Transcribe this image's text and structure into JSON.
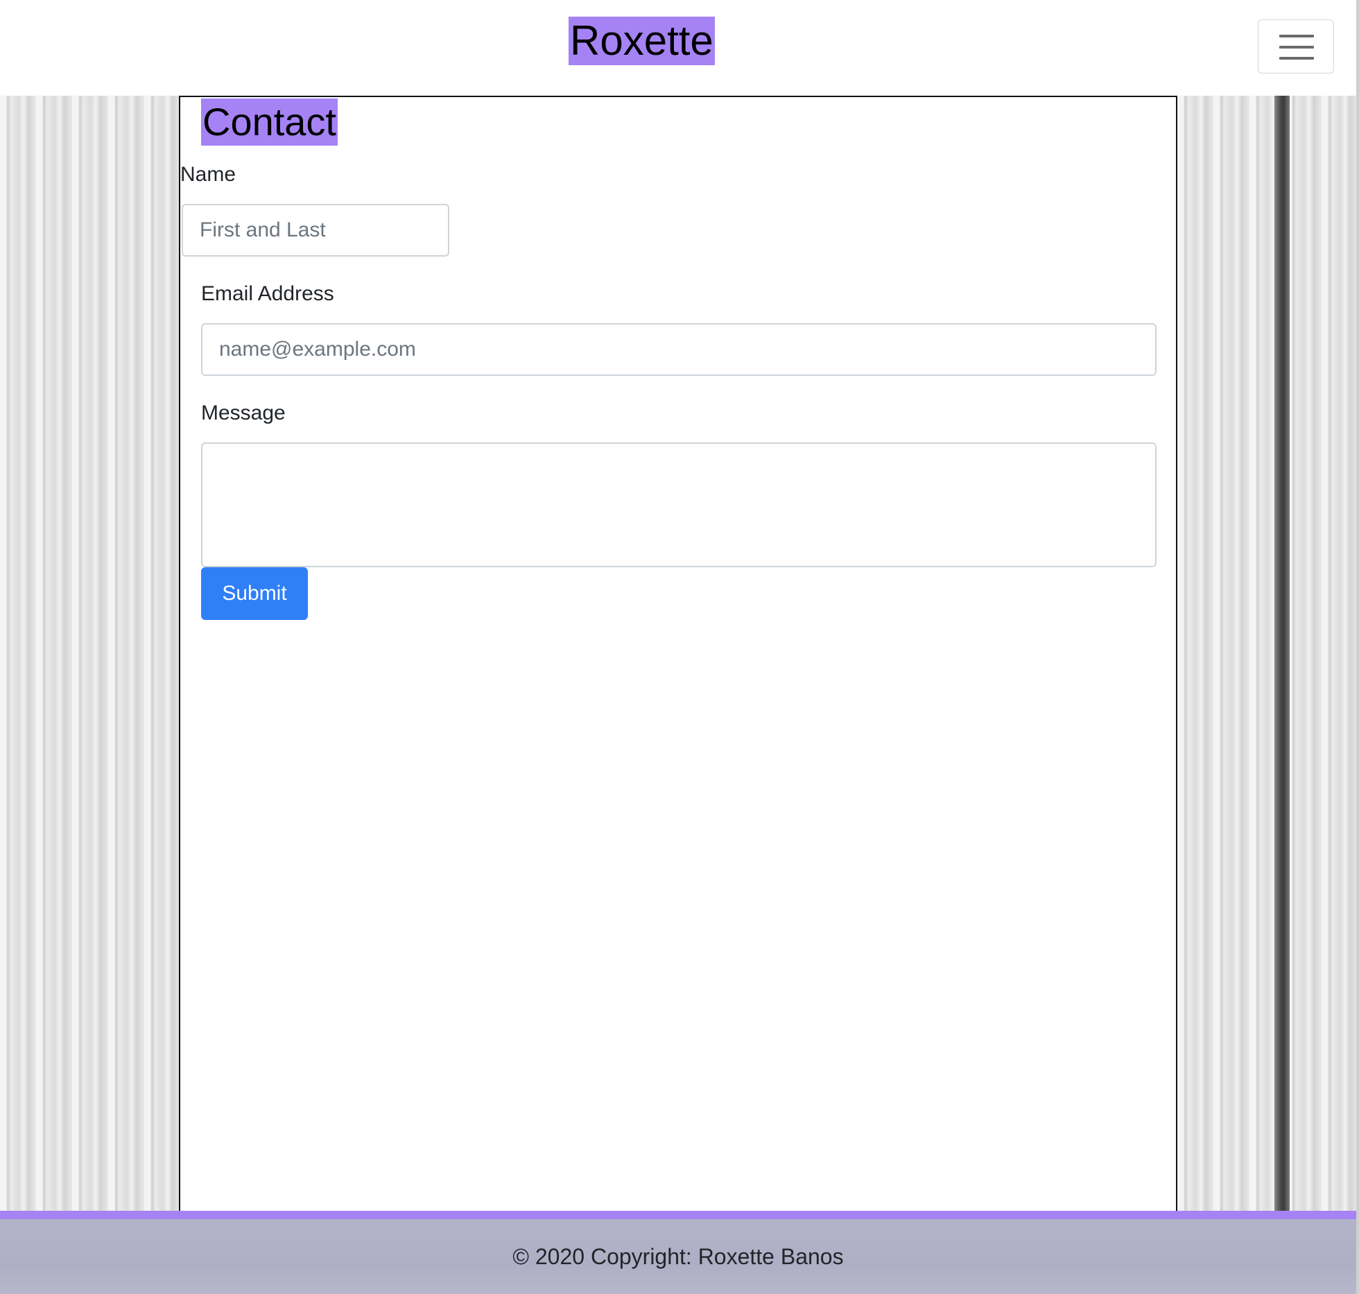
{
  "header": {
    "brand": "Roxette",
    "menu_icon": "hamburger-menu-icon"
  },
  "main": {
    "title": "Contact",
    "form": {
      "name": {
        "label": "Name",
        "placeholder": "First and Last",
        "value": ""
      },
      "email": {
        "label": "Email Address",
        "placeholder": "name@example.com",
        "value": ""
      },
      "message": {
        "label": "Message",
        "value": ""
      },
      "submit_label": "Submit"
    }
  },
  "footer": {
    "text": "© 2020 Copyright: Roxette Banos"
  },
  "colors": {
    "highlight": "#a583f5",
    "primary_button": "#2f7ff7",
    "footer_bg": "#b3b3c9"
  }
}
